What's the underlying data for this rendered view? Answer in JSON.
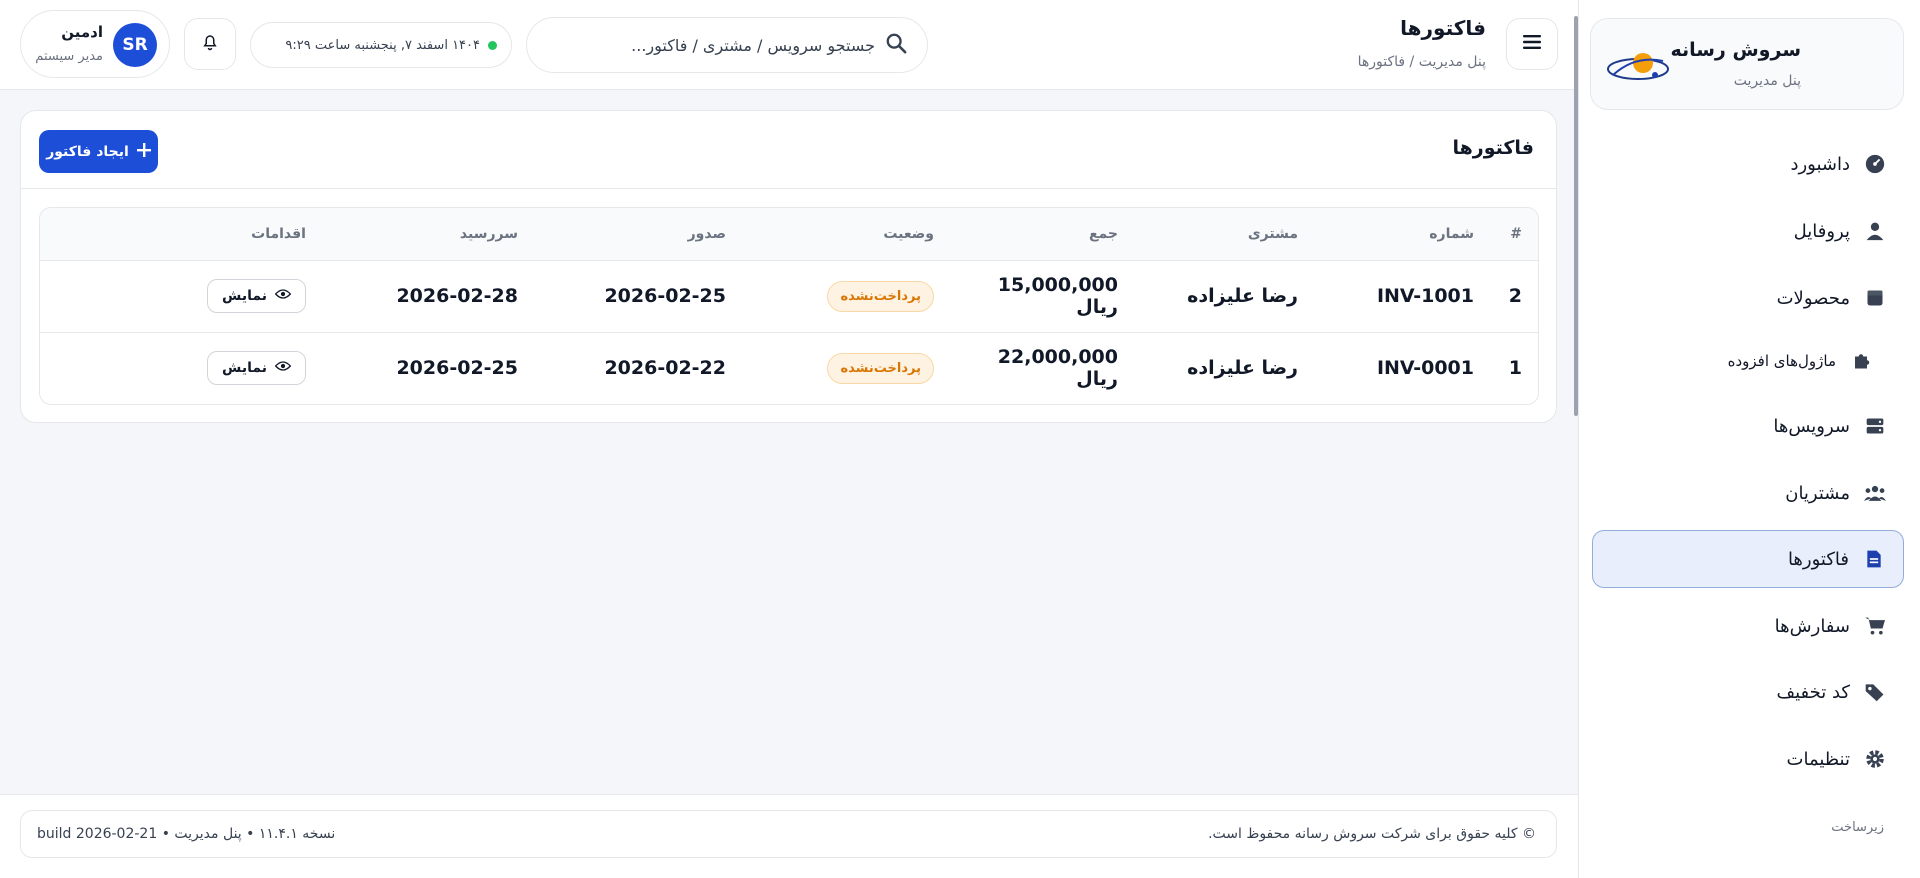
{
  "sidebar": {
    "brand_title": "سروش رسانه",
    "brand_subtitle": "پنل مدیریت",
    "items": [
      {
        "label": "داشبورد",
        "icon": "dashboard-gauge-icon"
      },
      {
        "label": "پروفایل",
        "icon": "user-icon"
      },
      {
        "label": "محصولات",
        "icon": "box-icon"
      },
      {
        "label": "ماژول‌های افزوده",
        "icon": "puzzle-icon"
      },
      {
        "label": "سرویس‌ها",
        "icon": "server-icon"
      },
      {
        "label": "مشتریان",
        "icon": "users-icon"
      },
      {
        "label": "فاکتورها",
        "icon": "invoice-icon",
        "active": true
      },
      {
        "label": "سفارش‌ها",
        "icon": "cart-icon"
      },
      {
        "label": "کد تخفیف",
        "icon": "tags-icon"
      },
      {
        "label": "تنظیمات",
        "icon": "gear-icon"
      }
    ],
    "section_label": "زیرساخت"
  },
  "header": {
    "title": "فاکتورها",
    "breadcrumb": "پنل مدیریت / فاکتورها",
    "search_placeholder": "جستجو سرویس / مشتری / فاکتور...",
    "datetime": "۱۴۰۴ اسفند ۷, پنجشنبه ساعت ۹:۲۹",
    "user_initials": "SR",
    "user_name": "ادمین",
    "user_role": "مدیر سیستم"
  },
  "card": {
    "title": "فاکتورها",
    "create_label": "ایجاد فاکتور"
  },
  "table": {
    "columns": [
      "#",
      "شماره",
      "مشتری",
      "جمع",
      "وضعیت",
      "صدور",
      "سررسید",
      "اقدامات"
    ],
    "rows": [
      {
        "index": "2",
        "number": "INV-1001",
        "customer": "رضا علیزاده",
        "total": "15,000,000 ریال",
        "status": "پرداخت‌نشده",
        "issued": "2026-02-25",
        "due": "2026-02-28",
        "action": "نمایش"
      },
      {
        "index": "1",
        "number": "INV-0001",
        "customer": "رضا علیزاده",
        "total": "22,000,000 ریال",
        "status": "پرداخت‌نشده",
        "issued": "2026-02-22",
        "due": "2026-02-25",
        "action": "نمایش"
      }
    ]
  },
  "footer": {
    "copyright": "© کلیه حقوق برای شرکت سروش رسانه محفوظ است.",
    "version": "نسخه ۱۱.۴.۱ • پنل مدیریت • build 2026-02-21"
  },
  "colors": {
    "accent": "#1d4ed8",
    "status_unpaid": "#d97706",
    "active_nav_bg": "#e8eefb"
  }
}
